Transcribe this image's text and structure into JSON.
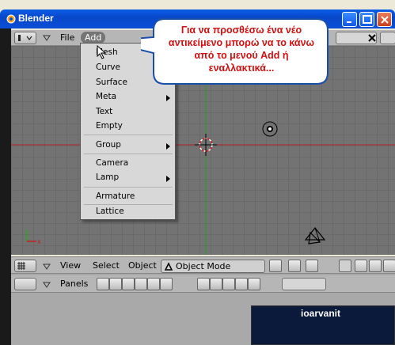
{
  "window": {
    "title": "Blender"
  },
  "header": {
    "menus": [
      "File",
      "Add"
    ]
  },
  "add_menu": {
    "items": [
      {
        "label": "Mesh",
        "submenu": false
      },
      {
        "label": "Curve",
        "submenu": false
      },
      {
        "label": "Surface",
        "submenu": false
      },
      {
        "label": "Meta",
        "submenu": true
      },
      {
        "label": "Text",
        "submenu": false
      },
      {
        "label": "Empty",
        "submenu": false
      },
      {
        "label": "Group",
        "submenu": true
      },
      {
        "label": "Camera",
        "submenu": false
      },
      {
        "label": "Lamp",
        "submenu": true
      },
      {
        "label": "Armature",
        "submenu": false
      },
      {
        "label": "Lattice",
        "submenu": false
      }
    ]
  },
  "callout": {
    "lines": [
      "Για να προσθέσω ένα νέο",
      "αντικείμενο μπορώ να το κάνω",
      "από το μενού Add ή",
      "εναλλακτικά..."
    ]
  },
  "view_header": {
    "view_label": "View",
    "select_label": "Select",
    "object_label": "Object",
    "mode_value": "Object Mode"
  },
  "panel_header": {
    "panels_label": "Panels"
  },
  "watermark": {
    "text": "ioarvanit"
  },
  "colors": {
    "titlebar": "#0847c9",
    "viewport": "#737373",
    "callout_text": "#d01010",
    "x_axis": "#b02020",
    "y_axis": "#20a020"
  }
}
